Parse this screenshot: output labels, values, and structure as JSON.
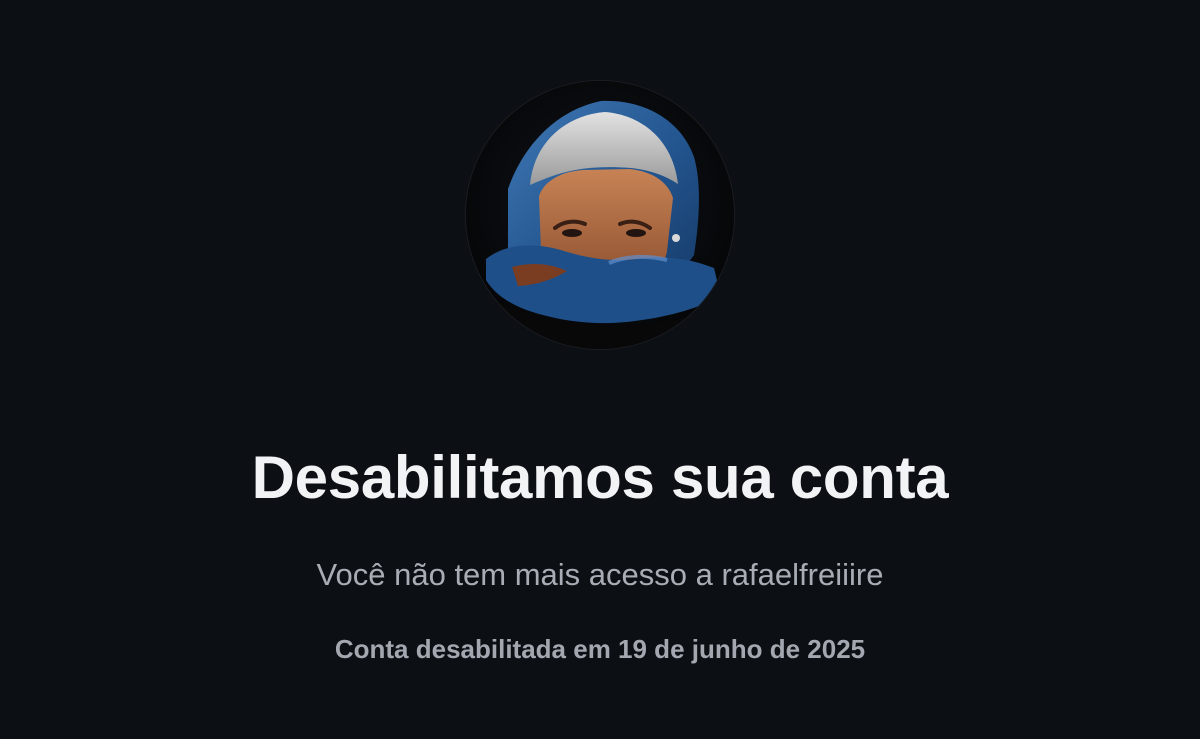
{
  "page": {
    "background_color": "#0c0f14",
    "title": "Desabilitamos sua conta",
    "subtitle": "Você não tem mais acesso a rafaelfreiiire",
    "disabled_notice": "Conta desabilitada em 19 de junho de 2025"
  },
  "avatar": {
    "icon": "profile-photo",
    "colors": {
      "scarf": "#2d5c96",
      "hair": "#c9c9c9",
      "skin": "#b66f43"
    }
  },
  "theme": {
    "title_color": "#f2f3f5",
    "subtitle_color": "#a8adb5",
    "notice_color": "#a3a8b0"
  }
}
